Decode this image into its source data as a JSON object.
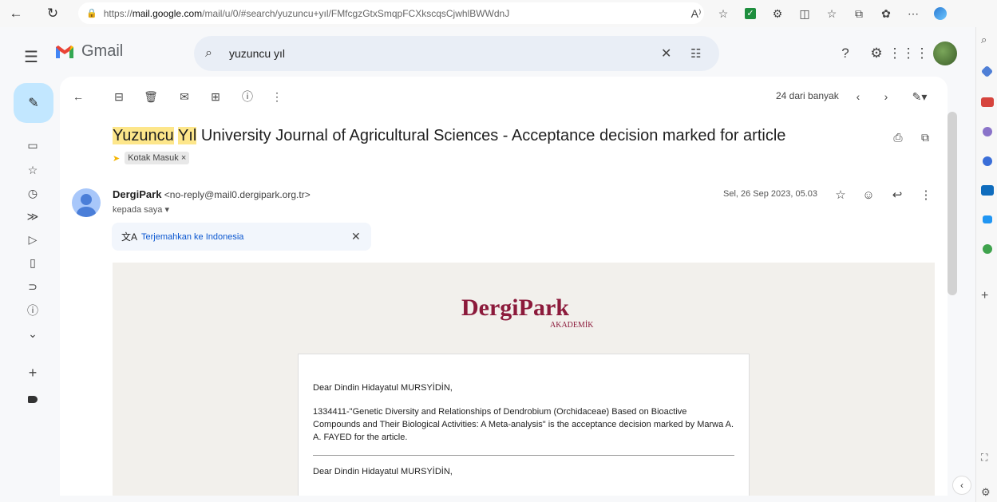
{
  "browser": {
    "url_prefix": "https://",
    "url_host": "mail.google.com",
    "url_path": "/mail/u/0/#search/yuzuncu+yıl/FMfcgzGtxSmqpFCXkscqsCjwhlBWWdnJ",
    "reader_label": "A⁾",
    "icons": [
      "back-icon",
      "refresh-icon",
      "lock-icon",
      "favorite-icon",
      "extensions-icon",
      "split-screen-icon",
      "collections-icon",
      "more-icon",
      "copilot-icon"
    ]
  },
  "gmail": {
    "app_name": "Gmail",
    "search_query": "yuzuncu yıl",
    "toolbar": {
      "count_text": "24 dari banyak"
    },
    "email": {
      "subject_hl1": "Yuzuncu",
      "subject_hl2": "Yıl",
      "subject_rest": "University Journal of Agricultural Sciences - Acceptance decision marked for article",
      "label_chip": "Kotak Masuk",
      "label_chip_close": "×",
      "sender_name": "DergiPark",
      "sender_email": "<no-reply@mail0.dergipark.org.tr>",
      "to_me": "kepada saya",
      "date": "Sel, 26 Sep 2023, 05.03",
      "translate_link": "Terjemahkan ke Indonesia",
      "body": {
        "logo_main": "DergiPark",
        "logo_sub": "AKADEMİK",
        "greeting": "Dear Dindin Hidayatul MURSYİDİN,",
        "paragraph": "1334411-\"Genetic Diversity and Relationships of Dendrobium (Orchidaceae) Based on Bioactive Compounds and Their Biological Activities: A Meta-analysis\" is the acceptance decision marked by Marwa A. A. FAYED for the article.",
        "greeting2": "Dear Dindin Hidayatul MURSYİDİN,"
      }
    }
  },
  "colors": {
    "accent": "#0b57d0",
    "compose_bg": "#c2e7ff",
    "highlight": "#fde68a",
    "dergipark": "#8c1a3b"
  }
}
